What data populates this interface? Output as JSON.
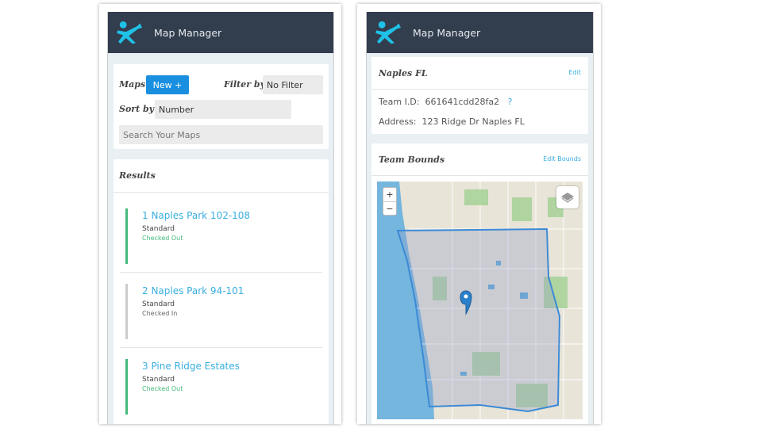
{
  "app_title": "Map Manager",
  "colors": {
    "header": "#323d4e",
    "accent": "#1a8fe0",
    "checked_out": "#45b97c",
    "checked_in": "#cccccc",
    "link": "#3aaee0"
  },
  "left": {
    "maps_label": "Maps",
    "new_button": "New +",
    "filter_label": "Filter by",
    "filter_value": "No Filter",
    "sort_label": "Sort by",
    "sort_value": "Number",
    "search_placeholder": "Search Your Maps",
    "results_title": "Results",
    "items": [
      {
        "name": "1 Naples Park 102-108",
        "type": "Standard",
        "status": "Checked Out"
      },
      {
        "name": "2 Naples Park 94-101",
        "type": "Standard",
        "status": "Checked In"
      },
      {
        "name": "3 Pine Ridge Estates",
        "type": "Standard",
        "status": "Checked Out"
      }
    ]
  },
  "right": {
    "team_name": "Naples FL",
    "edit_label": "Edit",
    "team_id_label": "Team I.D:",
    "team_id": "661641cdd28fa2",
    "help": "?",
    "address_label": "Address:",
    "address": "123 Ridge Dr Naples FL",
    "bounds_title": "Team Bounds",
    "edit_bounds_label": "Edit Bounds",
    "zoom_in": "+",
    "zoom_out": "−"
  }
}
